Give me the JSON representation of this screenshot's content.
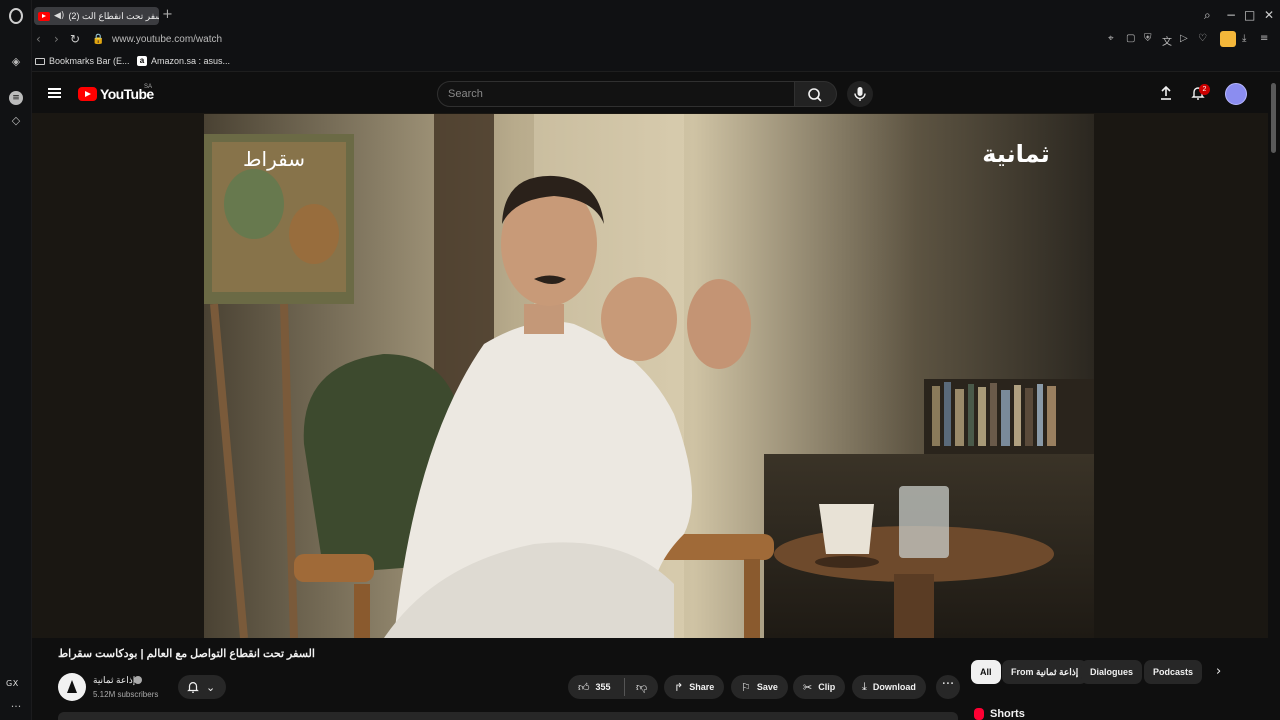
{
  "browser": {
    "tab_title": "(2) السفر تحت انقطاع الت",
    "url": "www.youtube.com/watch",
    "bookmarks": [
      {
        "label": "Bookmarks Bar (E..."
      },
      {
        "label": "Amazon.sa : asus..."
      }
    ],
    "sidebar_label": "GX"
  },
  "youtube": {
    "logo_text": "YouTube",
    "country_code": "SA",
    "search_placeholder": "Search",
    "notification_count": "2"
  },
  "video": {
    "overlay_left": "سقراط",
    "overlay_right": "ثمانية",
    "title": "السفر تحت انقطاع التواصل مع العالم | بودكاست سقراط",
    "channel_name": "إذاعة ثمانية",
    "subscribers": "5.12M subscribers",
    "actions": {
      "likes": "355",
      "share": "Share",
      "save": "Save",
      "clip": "Clip",
      "download": "Download"
    }
  },
  "chips": [
    {
      "label": "All",
      "active": true
    },
    {
      "label": "From إذاعة ثمانية",
      "active": false
    },
    {
      "label": "Dialogues",
      "active": false
    },
    {
      "label": "Podcasts",
      "active": false
    }
  ],
  "shorts_heading": "Shorts",
  "colors": {
    "background": "#0f0f0f",
    "brand_red": "#ff0000",
    "chip_bg": "#272727",
    "avatar": "#8b8df0"
  }
}
